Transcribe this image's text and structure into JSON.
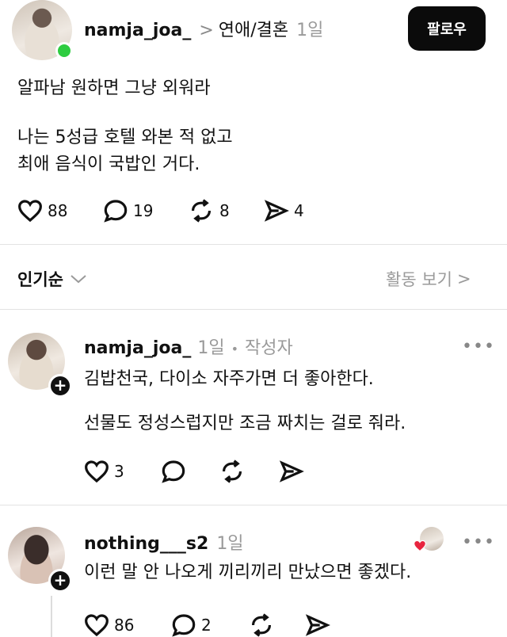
{
  "post": {
    "username": "namja_joa_",
    "chevron": ">",
    "category": "연애/결혼",
    "time": "1일",
    "follow_label": "팔로우",
    "title": "알파남 원하면 그냥 외워라",
    "body_line1": "나는 5성급 호텔 와본 적 없고",
    "body_line2": "최애 음식이 국밥인 거다.",
    "likes": "88",
    "comments": "19",
    "reposts": "8",
    "shares": "4"
  },
  "sort_bar": {
    "sort_label": "인기순",
    "activity_label": "활동 보기",
    "activity_chevron": ">"
  },
  "comments": [
    {
      "username": "namja_joa_",
      "time": "1일",
      "separator": "•",
      "author_tag": "작성자",
      "text_line1": "김밥천국, 다이소 자주가면 더 좋아한다.",
      "text_line2": "선물도 정성스럽지만 조금 짜치는 걸로 줘라.",
      "likes": "3",
      "more": "•••"
    },
    {
      "username": "nothing___s2",
      "time": "1일",
      "text_line1": "이런 말 안 나오게 끼리끼리 만났으면 좋겠다.",
      "likes": "86",
      "comments": "2",
      "more": "•••"
    }
  ],
  "icons": {
    "heart": "heart-icon",
    "comment": "comment-icon",
    "repost": "repost-icon",
    "share": "send-icon",
    "plus": "+"
  }
}
